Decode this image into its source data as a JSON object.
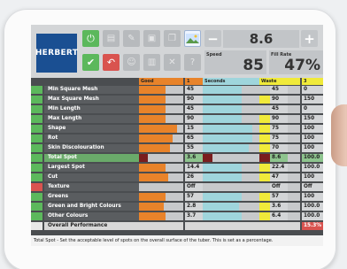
{
  "app": {
    "logo_text": "HERBERT"
  },
  "colors": {
    "orange": "#e8832a",
    "cyan": "#9fd5dc",
    "yellow": "#f0ea3a",
    "green": "#5cb85c",
    "red": "#d9534f",
    "selected": "#6aaa6a",
    "dark_red": "#7a1d1d"
  },
  "header": {
    "value_display": "8.6",
    "minus_label": "−",
    "plus_label": "+",
    "speed_label": "Speed",
    "speed_value": "85",
    "fill_rate_label": "Fill Rate",
    "fill_rate_value": "47%",
    "toolbar_icons": [
      "power-icon",
      "print-icon",
      "edit-icon",
      "save-icon",
      "copy-icon",
      "image-icon",
      "check-icon",
      "undo-icon",
      "users-icon",
      "chart-icon",
      "tools-icon",
      "help-icon"
    ]
  },
  "columns": {
    "good_label": "Good",
    "good_num": "1",
    "seconds_label": "Seconds",
    "seconds_num": "2",
    "waste_label": "Waste",
    "waste_num": "3"
  },
  "rows": [
    {
      "name": "Min Square Mesh",
      "status": "green",
      "v1": "45",
      "v2": "45",
      "v3": "0",
      "f1": 0.6,
      "f2": 0.6,
      "f3": 0.0
    },
    {
      "name": "Max Square Mesh",
      "status": "green",
      "v1": "90",
      "v2": "90",
      "v3": "150",
      "f1": 0.6,
      "f2": 0.6,
      "f3": 0.55
    },
    {
      "name": "Min Length",
      "status": "green",
      "v1": "45",
      "v2": "45",
      "v3": "0",
      "f1": 0.6,
      "f2": 0.6,
      "f3": 0.0
    },
    {
      "name": "Max Length",
      "status": "green",
      "v1": "90",
      "v2": "90",
      "v3": "150",
      "f1": 0.6,
      "f2": 0.6,
      "f3": 0.55
    },
    {
      "name": "Shape",
      "status": "green",
      "v1": "15",
      "v2": "75",
      "v3": "100",
      "f1": 0.85,
      "f2": 0.75,
      "f3": 0.55
    },
    {
      "name": "Rot",
      "status": "green",
      "v1": "65",
      "v2": "75",
      "v3": "100",
      "f1": 0.75,
      "f2": 0.75,
      "f3": 0.55
    },
    {
      "name": "Skin Discolouration",
      "status": "green",
      "v1": "55",
      "v2": "70",
      "v3": "100",
      "f1": 0.7,
      "f2": 0.7,
      "f3": 0.55
    },
    {
      "name": "Total Spot",
      "status": "green",
      "v1": "3.6",
      "v2": "8.6",
      "v3": "100.0",
      "f1": 0.2,
      "f2": 0.15,
      "f3": 0.55,
      "selected": true
    },
    {
      "name": "Largest Spot",
      "status": "green",
      "v1": "14.4",
      "v2": "22.4",
      "v3": "100.0",
      "f1": 0.6,
      "f2": 0.6,
      "f3": 0.55
    },
    {
      "name": "Cut",
      "status": "green",
      "v1": "26",
      "v2": "47",
      "v3": "100",
      "f1": 0.65,
      "f2": 0.6,
      "f3": 0.55
    },
    {
      "name": "Texture",
      "status": "red",
      "v1": "Off",
      "v2": "Off",
      "v3": "Off",
      "f1": 0.0,
      "f2": 0.0,
      "f3": 0.0
    },
    {
      "name": "Greens",
      "status": "green",
      "v1": "57",
      "v2": "57",
      "v3": "100",
      "f1": 0.6,
      "f2": 0.6,
      "f3": 0.55
    },
    {
      "name": "Green and Bright Colours",
      "status": "green",
      "v1": "2.8",
      "v2": "3.6",
      "v3": "100.0",
      "f1": 0.55,
      "f2": 0.55,
      "f3": 0.55
    },
    {
      "name": "Other Colours",
      "status": "green",
      "v1": "3.7",
      "v2": "6.4",
      "v3": "100.0",
      "f1": 0.6,
      "f2": 0.6,
      "f3": 0.55
    },
    {
      "name": "Overall Performance",
      "status": "none",
      "v1": "",
      "v2": "",
      "v3": "15.3%",
      "overall": true,
      "f1": 0.0,
      "f2": 0.0,
      "f3": 0.0
    }
  ],
  "footer_text": "Total Spot - Set the acceptable level of spots on the overall surface of the tuber. This is set as a percentage."
}
